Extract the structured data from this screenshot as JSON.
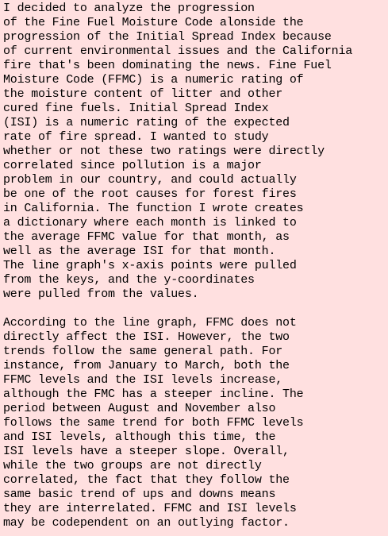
{
  "paragraphs": [
    [
      "I decided to analyze the progression",
      "of the Fine Fuel Moisture Code alonside the",
      "progression of the Initial Spread Index because",
      "of current environmental issues and the California",
      "fire that's been dominating the news. Fine Fuel",
      "Moisture Code (FFMC) is a numeric rating of",
      "the moisture content of litter and other",
      "cured fine fuels. Initial Spread Index",
      "(ISI) is a numeric rating of the expected",
      "rate of fire spread. I wanted to study",
      "whether or not these two ratings were directly",
      "correlated since pollution is a major",
      "problem in our country, and could actually",
      "be one of the root causes for forest fires",
      "in California. The function I wrote creates",
      "a dictionary where each month is linked to",
      "the average FFMC value for that month, as",
      "well as the average ISI for that month.",
      "The line graph's x-axis points were pulled",
      "from the keys, and the y-coordinates",
      "were pulled from the values."
    ],
    [
      "According to the line graph, FFMC does not",
      "directly affect the ISI. However, the two",
      "trends follow the same general path. For",
      "instance, from January to March, both the",
      "FFMC levels and the ISI levels increase,",
      "although the FMC has a steeper incline. The",
      "period between August and November also",
      "follows the same trend for both FFMC levels",
      "and ISI levels, although this time, the",
      "ISI levels have a steeper slope. Overall,",
      "while the two groups are not directly",
      "correlated, the fact that they follow the",
      "same basic trend of ups and downs means",
      "they are interrelated. FFMC and ISI levels",
      "may be codependent on an outlying factor."
    ]
  ]
}
